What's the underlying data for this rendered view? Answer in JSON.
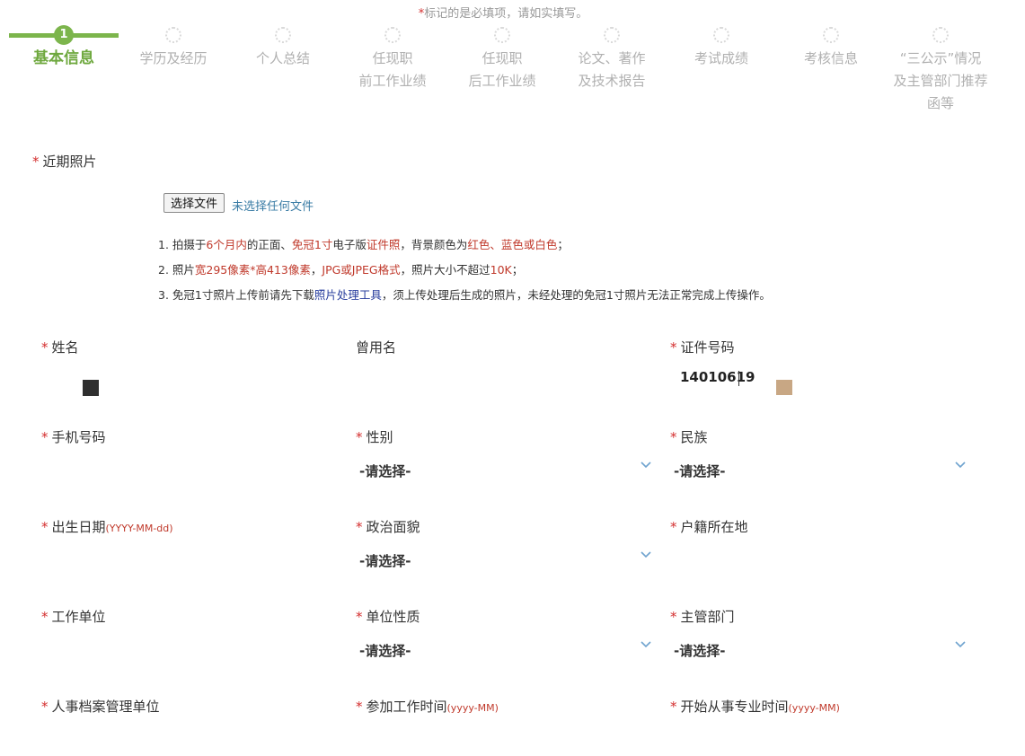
{
  "notice": {
    "star": "*",
    "text": "标记的是必填项，请如实填写。"
  },
  "steps": [
    {
      "number": "1",
      "line1": "基本信息",
      "line2": "",
      "line3": ""
    },
    {
      "number": "",
      "line1": "学历及经历",
      "line2": "",
      "line3": ""
    },
    {
      "number": "",
      "line1": "个人总结",
      "line2": "",
      "line3": ""
    },
    {
      "number": "",
      "line1": "任现职",
      "line2": "前工作业绩",
      "line3": ""
    },
    {
      "number": "",
      "line1": "任现职",
      "line2": "后工作业绩",
      "line3": ""
    },
    {
      "number": "",
      "line1": "论文、著作",
      "line2": "及技术报告",
      "line3": ""
    },
    {
      "number": "",
      "line1": "考试成绩",
      "line2": "",
      "line3": ""
    },
    {
      "number": "",
      "line1": "考核信息",
      "line2": "",
      "line3": ""
    },
    {
      "number": "",
      "line1": "“三公示”情况",
      "line2": "及主管部门推荐",
      "line3": "函等"
    }
  ],
  "photo": {
    "label": "近期照片",
    "button": "选择文件",
    "status": "未选择任何文件",
    "rules": {
      "r1": {
        "a": "1. 拍摄于",
        "b": "6个月内",
        "c": "的正面、",
        "d": "免冠1寸",
        "e": "电子版",
        "f": "证件照",
        "g": "，背景颜色为",
        "h": "红色、蓝色或白色",
        "i": "；"
      },
      "r2": {
        "a": "2. 照片",
        "b": "宽295像素*高413像素",
        "c": "，",
        "d": "JPG或JPEG格式",
        "e": "，照片大小不超过",
        "f": "10K",
        "g": "；"
      },
      "r3": {
        "a": "3. 免冠1寸照片上传前请先下载",
        "b": "照片处理工具",
        "c": "，须上传处理后生成的照片，未经处理的免冠1寸照片无法正常完成上传操作。"
      }
    }
  },
  "required_star": "*",
  "select_placeholder": "-请选择-",
  "fields": {
    "name": "姓名",
    "former_name": "曾用名",
    "id_number": "证件号码",
    "id_value": "14010619",
    "phone": "手机号码",
    "gender": "性别",
    "ethnicity": "民族",
    "birth_date": "出生日期",
    "birth_date_fmt": "(YYYY-MM-dd)",
    "political": "政治面貌",
    "household": "户籍所在地",
    "employer": "工作单位",
    "employer_type": "单位性质",
    "authority": "主管部门",
    "archive_unit": "人事档案管理单位",
    "work_start": "参加工作时间",
    "work_start_fmt": "(yyyy-MM)",
    "profession_start": "开始从事专业时间",
    "profession_start_fmt": "(yyyy-MM)"
  },
  "colors": {
    "accent": "#7cb54c",
    "required": "#d42f2f",
    "highlight": "#c0392b",
    "chevron": "#6fa3cf"
  }
}
